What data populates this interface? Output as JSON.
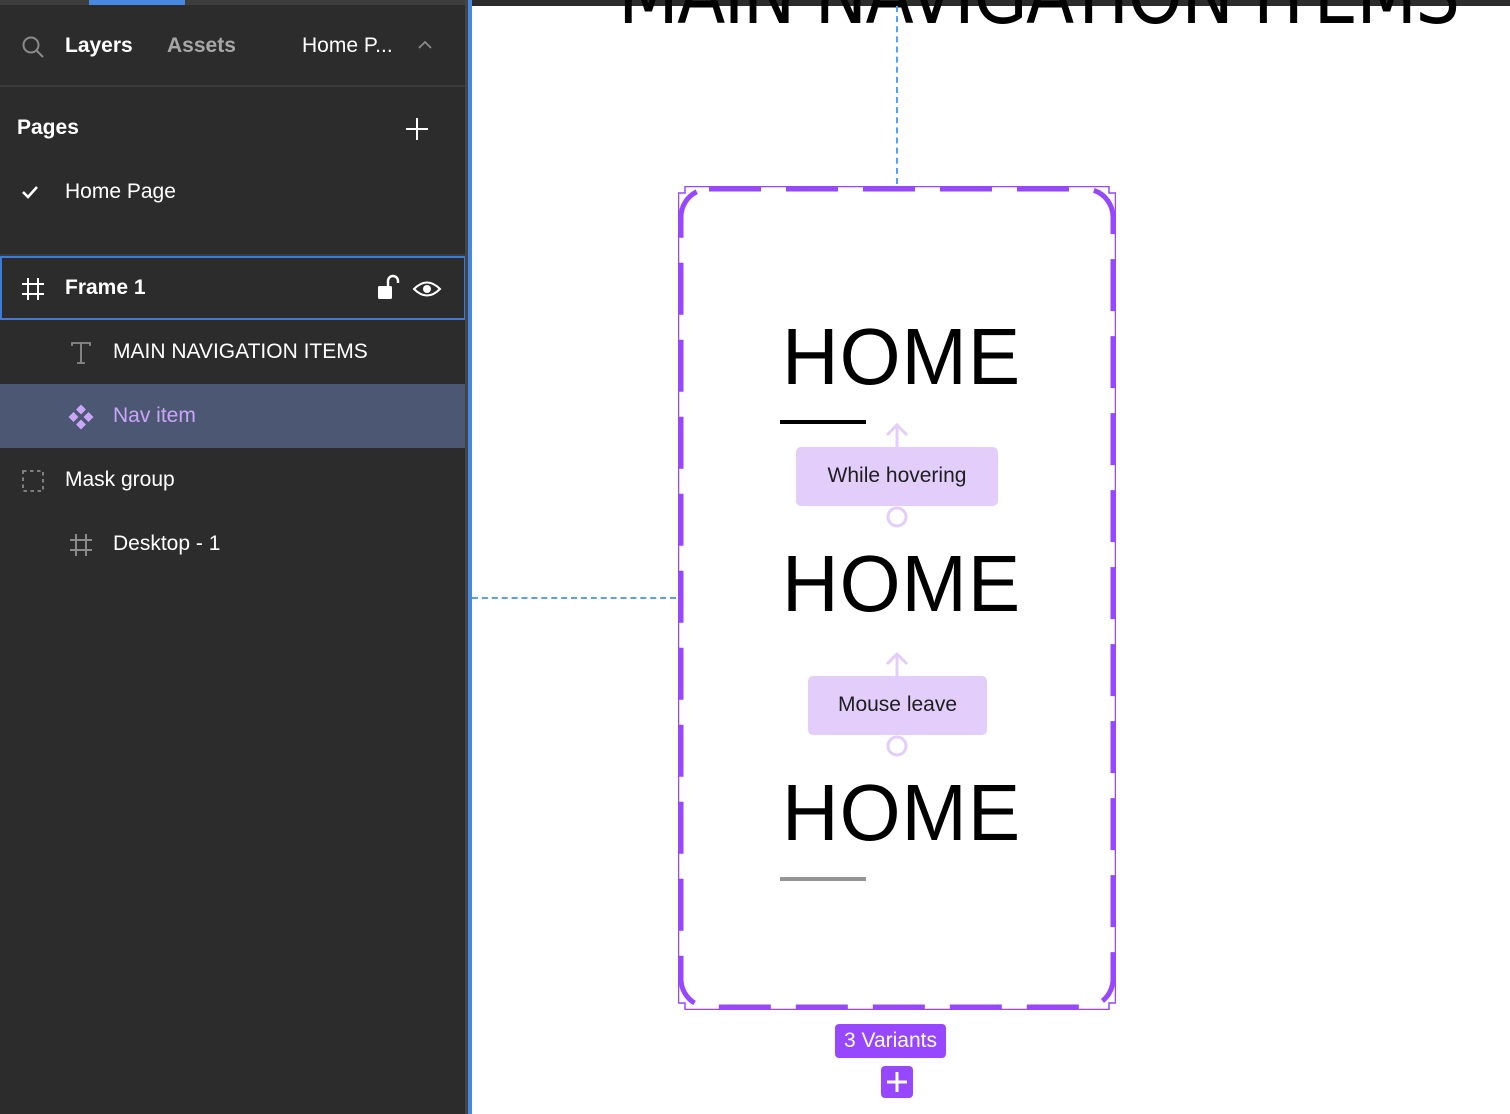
{
  "sidebar": {
    "tabs": {
      "layers": "Layers",
      "assets": "Assets"
    },
    "page_selector": "Home P...",
    "pages": {
      "title": "Pages",
      "items": [
        {
          "label": "Home Page",
          "selected": true
        }
      ]
    },
    "layers": [
      {
        "name": "Frame 1",
        "type": "frame",
        "state": "hovered",
        "locked": false,
        "visible": true
      },
      {
        "name": "MAIN NAVIGATION ITEMS",
        "type": "text"
      },
      {
        "name": "Nav item",
        "type": "component-set",
        "state": "selected"
      },
      {
        "name": "Mask group",
        "type": "mask-group"
      },
      {
        "name": "Desktop - 1",
        "type": "frame"
      }
    ]
  },
  "canvas": {
    "title_text": "MAIN NAVIGATION ITEMS",
    "component_set": {
      "variants": [
        {
          "label": "HOME",
          "underline": "black"
        },
        {
          "label": "HOME",
          "underline": "none"
        },
        {
          "label": "HOME",
          "underline": "gray"
        }
      ],
      "interactions": [
        {
          "label": "While hovering"
        },
        {
          "label": "Mouse leave"
        }
      ],
      "badge": "3 Variants"
    }
  },
  "colors": {
    "sidebar_bg": "#2c2c2c",
    "selection_blue": "#4589e2",
    "component_purple": "#9747ff",
    "interaction_bg": "#e2cdfb",
    "selected_row_bg": "#4c5773",
    "component_text": "#c9a6f7"
  }
}
